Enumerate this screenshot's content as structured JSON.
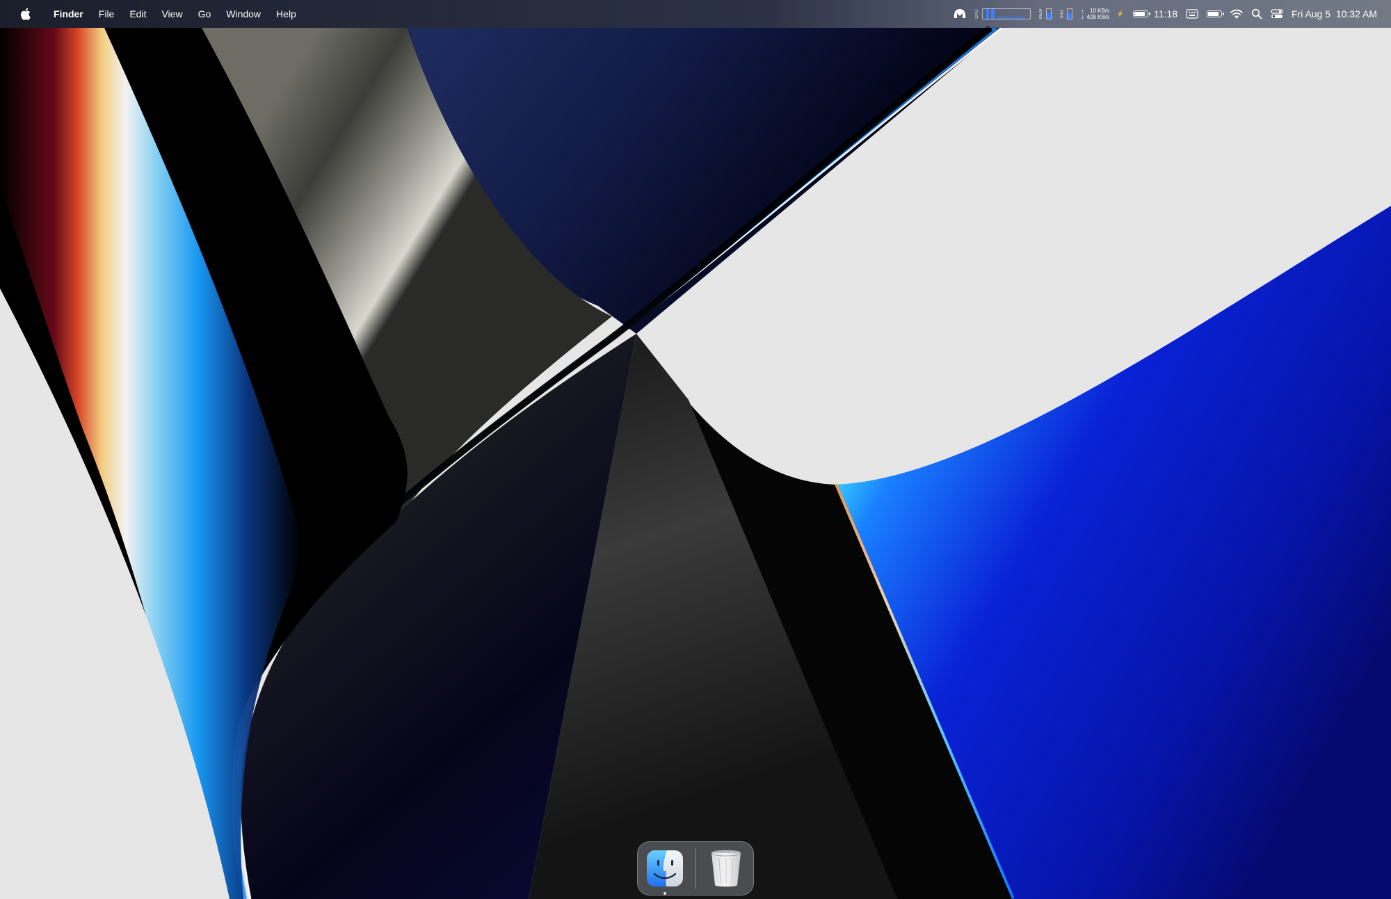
{
  "menubar": {
    "app_name": "Finder",
    "menus": [
      "File",
      "Edit",
      "View",
      "Go",
      "Window",
      "Help"
    ],
    "status": {
      "cpu_label": "CPU",
      "mem_label": "MEM",
      "ssd_label": "SSD",
      "network_up": "10 KB/s",
      "network_down": "428 KB/s",
      "battery_time": "11:18",
      "cpu_level": 0.15,
      "mem_level": 0.55,
      "ssd_level": 0.6,
      "battery_level": 0.85
    },
    "datetime": "Fri Aug 5  10:32 AM"
  },
  "dock": {
    "items": [
      {
        "name": "Finder",
        "icon": "finder-icon",
        "running": true
      },
      {
        "name": "Trash",
        "icon": "trash-icon",
        "running": false
      }
    ]
  },
  "colors": {
    "accent_blue": "#3d7fff",
    "wallpaper_blue": "#0a1ad8",
    "wallpaper_light": "#e6e6e6"
  }
}
